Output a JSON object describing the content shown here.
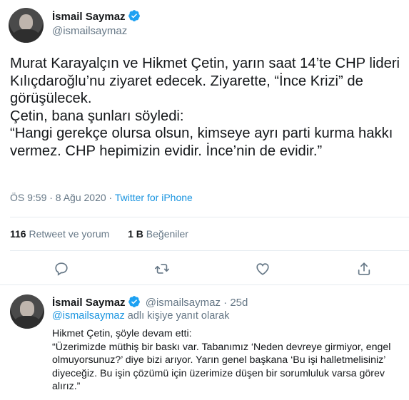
{
  "main_tweet": {
    "author_name": "İsmail Saymaz",
    "author_handle": "@ismailsaymaz",
    "text": "Murat Karayalçın ve Hikmet Çetin, yarın saat 14’te CHP lideri Kılıçdaroğlu’nu ziyaret edecek. Ziyarette, “İnce Krizi” de görüşülecek.\nÇetin, bana şunları söyledi:\n“Hangi gerekçe olursa olsun, kimseye ayrı parti kurma hakkı vermez. CHP hepimizin evidir. İnce’nin de evidir.”",
    "timestamp": "ÖS 9:59 · 8 Ağu 2020",
    "separator": " · ",
    "source": "Twitter for iPhone",
    "retweet_count": "116",
    "retweet_label": "Retweet ve yorum",
    "like_count": "1 B",
    "like_label": "Beğeniler"
  },
  "actions": [
    {
      "name": "reply",
      "icon": "reply-icon"
    },
    {
      "name": "retweet",
      "icon": "retweet-icon"
    },
    {
      "name": "like",
      "icon": "heart-icon"
    },
    {
      "name": "share",
      "icon": "share-icon"
    }
  ],
  "reply_tweet": {
    "author_name": "İsmail Saymaz",
    "author_handle": "@ismailsaymaz",
    "dot": " · ",
    "age": "25d",
    "reply_mention": "@ismailsaymaz",
    "reply_suffix": " adlı kişiye yanıt olarak",
    "text": "Hikmet Çetin, şöyle devam etti:\n“Üzerimizde müthiş bir baskı var. Tabanımız ‘Neden devreye girmiyor, engel olmuyorsunuz?’ diye bizi arıyor. Yarın genel başkana ‘Bu işi halletmelisiniz’ diyeceğiz. Bu işin çözümü için üzerimize düşen bir sorumluluk varsa görev alırız.”"
  },
  "colors": {
    "verified": "#1da1f2",
    "link": "#1b95e0",
    "muted": "#657786",
    "divider": "#e6ecf0"
  }
}
